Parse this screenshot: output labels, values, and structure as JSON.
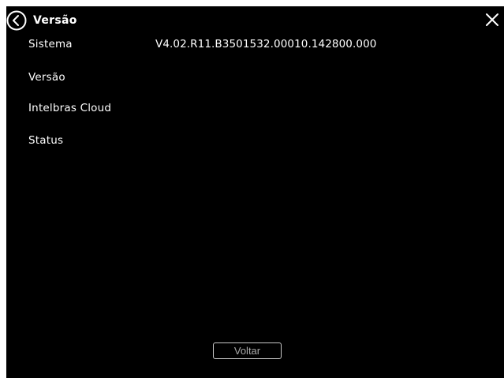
{
  "header": {
    "title": "Versão",
    "back_icon": "chevron-left-circle-icon",
    "close_icon": "close-icon"
  },
  "rows": [
    {
      "label": "Sistema",
      "value": "V4.02.R11.B3501532.00010.142800.000"
    },
    {
      "label": "Versão",
      "value": ""
    },
    {
      "label": "Intelbras Cloud",
      "value": ""
    },
    {
      "label": "Status",
      "value": ""
    }
  ],
  "footer": {
    "voltar_label": "Voltar"
  },
  "colors": {
    "background": "#000000",
    "text": "#ffffff",
    "button_text": "#aaaaaa",
    "button_border": "#c8c8c8"
  }
}
